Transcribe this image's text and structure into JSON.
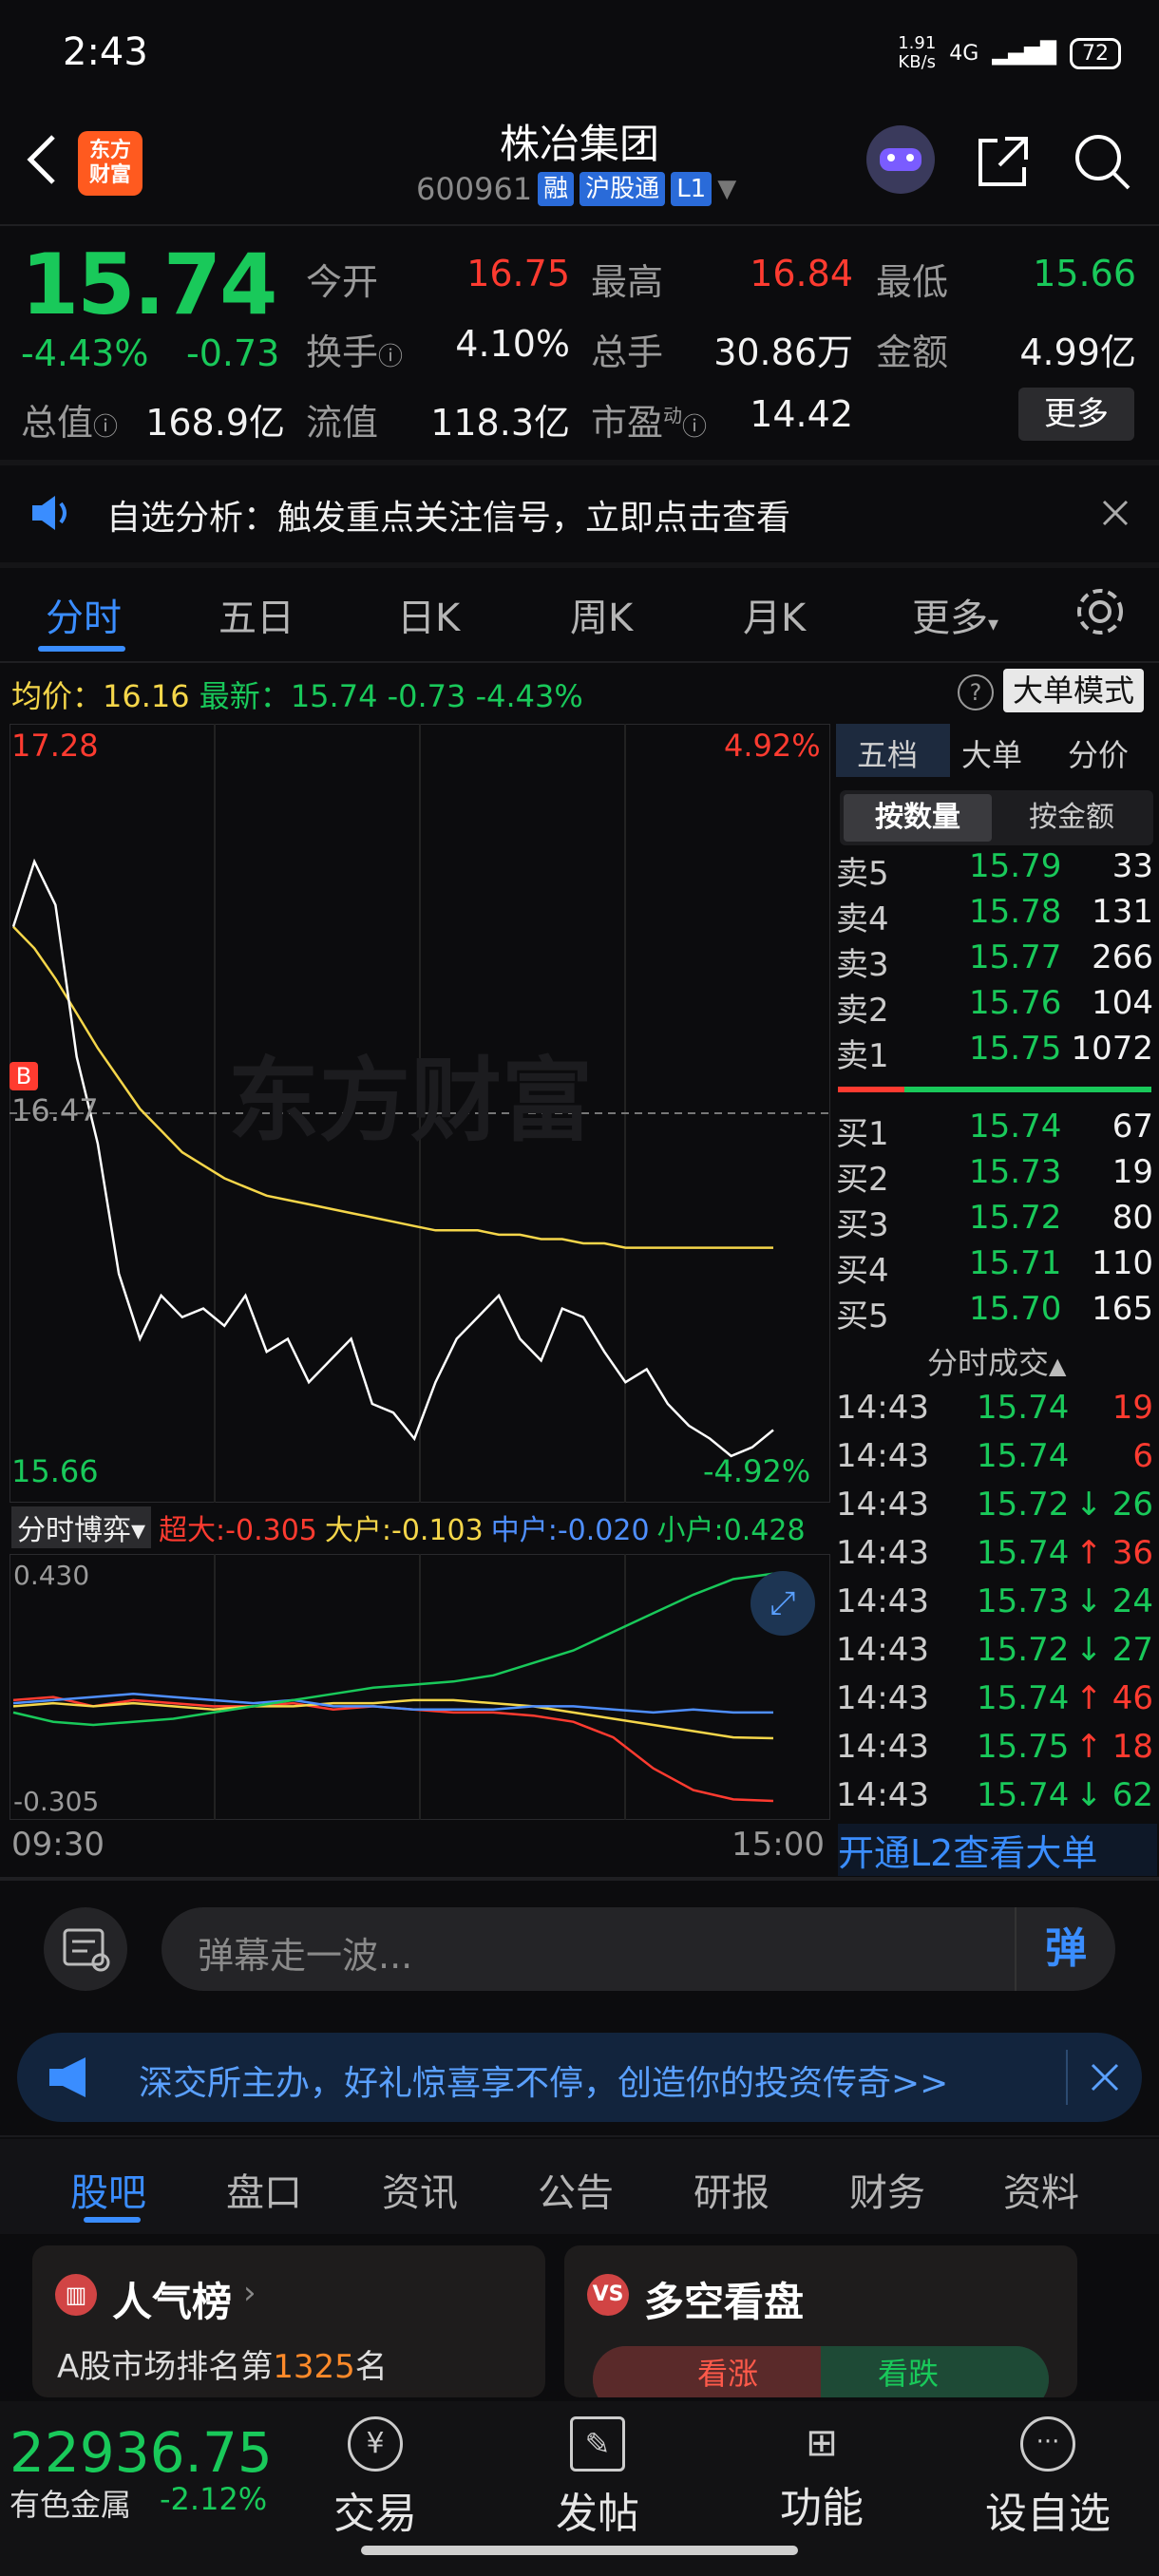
{
  "status": {
    "time": "2:43",
    "net_speed": "1.91\nKB/s",
    "signal": "4G",
    "battery": "72"
  },
  "header": {
    "title": "株冶集团",
    "code": "600961",
    "tags": [
      "融",
      "沪股通",
      "L1"
    ],
    "logo": "东方\n财富"
  },
  "quote": {
    "price": "15.74",
    "pct": "-4.43%",
    "chg": "-0.73",
    "fields": [
      {
        "label": "今开",
        "value": "16.75",
        "color": "red"
      },
      {
        "label": "最高",
        "value": "16.84",
        "color": "red"
      },
      {
        "label": "最低",
        "value": "15.66",
        "color": "green"
      },
      {
        "label": "换手",
        "value": "4.10%",
        "color": "white"
      },
      {
        "label": "总手",
        "value": "30.86万",
        "color": "white"
      },
      {
        "label": "金额",
        "value": "4.99亿",
        "color": "white"
      },
      {
        "label": "总值",
        "value": "168.9亿",
        "color": "white"
      },
      {
        "label": "流值",
        "value": "118.3亿",
        "color": "white"
      },
      {
        "label": "市盈",
        "value": "14.42",
        "color": "white"
      }
    ],
    "pe_sup": "动",
    "more_label": "更多"
  },
  "notice": {
    "text": "自选分析：触发重点关注信号，立即点击查看"
  },
  "tabs": [
    "分时",
    "五日",
    "日K",
    "周K",
    "月K",
    "更多"
  ],
  "chart_header": {
    "avg_label": "均价：",
    "avg_value": "16.16",
    "latest_label": "最新：",
    "latest_value": "15.74",
    "chg": "-0.73",
    "pct": "-4.43%",
    "mode": "大单模式"
  },
  "chart_data": {
    "type": "line",
    "y_high": "17.28",
    "y_high_pct": "4.92%",
    "y_low": "15.66",
    "y_low_pct": "-4.92%",
    "prev_close": "16.47",
    "watermark": "东方财富",
    "x_start": "09:30",
    "x_end": "15:00",
    "price_range": [
      15.66,
      17.28
    ],
    "series": [
      {
        "name": "price",
        "color": "#ffffff",
        "values": [
          16.9,
          17.05,
          16.95,
          16.6,
          16.4,
          16.1,
          15.95,
          16.05,
          16.0,
          16.02,
          15.98,
          16.05,
          15.92,
          15.95,
          15.85,
          15.9,
          15.95,
          15.8,
          15.78,
          15.72,
          15.85,
          15.95,
          16.0,
          16.05,
          15.95,
          15.9,
          16.02,
          16.0,
          15.92,
          15.85,
          15.88,
          15.8,
          15.75,
          15.72,
          15.68,
          15.7,
          15.74
        ]
      },
      {
        "name": "avg",
        "color": "#f5d64a",
        "values": [
          16.9,
          16.85,
          16.78,
          16.7,
          16.62,
          16.55,
          16.48,
          16.43,
          16.38,
          16.35,
          16.32,
          16.3,
          16.28,
          16.27,
          16.26,
          16.25,
          16.24,
          16.23,
          16.22,
          16.21,
          16.2,
          16.2,
          16.2,
          16.19,
          16.19,
          16.18,
          16.18,
          16.17,
          16.17,
          16.16,
          16.16,
          16.16,
          16.16,
          16.16,
          16.16,
          16.16,
          16.16
        ]
      }
    ],
    "flow": {
      "title": "分时博弈",
      "labels": [
        {
          "text": "超大:-0.305",
          "color": "#ff3b30"
        },
        {
          "text": "大户:-0.103",
          "color": "#f5d64a"
        },
        {
          "text": "中户:-0.020",
          "color": "#4f8fff"
        },
        {
          "text": "小户:0.428",
          "color": "#19c95a"
        }
      ],
      "y_max": "0.430",
      "y_min": "-0.305",
      "range": [
        -0.305,
        0.43
      ],
      "series": [
        {
          "name": "超大",
          "color": "#ff3b30",
          "values": [
            0.02,
            0.03,
            0.0,
            0.02,
            0.01,
            0.0,
            0.0,
            0.01,
            -0.01,
            0.0,
            -0.01,
            -0.02,
            -0.02,
            -0.03,
            -0.05,
            -0.1,
            -0.2,
            -0.27,
            -0.3,
            -0.305
          ]
        },
        {
          "name": "大户",
          "color": "#f5d64a",
          "values": [
            0.0,
            0.01,
            0.0,
            0.01,
            0.0,
            -0.01,
            0.0,
            0.0,
            0.01,
            0.01,
            0.02,
            0.02,
            0.01,
            0.0,
            -0.02,
            -0.04,
            -0.06,
            -0.08,
            -0.1,
            -0.103
          ]
        },
        {
          "name": "中户",
          "color": "#4f8fff",
          "values": [
            0.01,
            0.02,
            0.03,
            0.04,
            0.03,
            0.02,
            0.01,
            0.02,
            0.0,
            0.0,
            -0.01,
            -0.01,
            -0.01,
            0.0,
            0.0,
            -0.01,
            -0.02,
            -0.01,
            -0.02,
            -0.02
          ]
        },
        {
          "name": "小户",
          "color": "#19c95a",
          "values": [
            -0.02,
            -0.05,
            -0.06,
            -0.05,
            -0.04,
            -0.02,
            0.0,
            0.02,
            0.04,
            0.06,
            0.07,
            0.08,
            0.1,
            0.14,
            0.18,
            0.24,
            0.3,
            0.36,
            0.41,
            0.428
          ]
        }
      ]
    }
  },
  "right_panel": {
    "tabs": [
      "五档",
      "大单",
      "分价"
    ],
    "sub_tabs": [
      "按数量",
      "按金额"
    ],
    "sells": [
      {
        "label": "卖5",
        "price": "15.79",
        "vol": "33"
      },
      {
        "label": "卖4",
        "price": "15.78",
        "vol": "131"
      },
      {
        "label": "卖3",
        "price": "15.77",
        "vol": "266"
      },
      {
        "label": "卖2",
        "price": "15.76",
        "vol": "104"
      },
      {
        "label": "卖1",
        "price": "15.75",
        "vol": "1072"
      }
    ],
    "buys": [
      {
        "label": "买1",
        "price": "15.74",
        "vol": "67"
      },
      {
        "label": "买2",
        "price": "15.73",
        "vol": "19"
      },
      {
        "label": "买3",
        "price": "15.72",
        "vol": "80"
      },
      {
        "label": "买4",
        "price": "15.71",
        "vol": "110"
      },
      {
        "label": "买5",
        "price": "15.70",
        "vol": "165"
      }
    ],
    "trades_title": "分时成交",
    "trades": [
      {
        "time": "14:43",
        "price": "15.74",
        "arrow": "",
        "vol": "19",
        "vc": "red"
      },
      {
        "time": "14:43",
        "price": "15.74",
        "arrow": "",
        "vol": "6",
        "vc": "red"
      },
      {
        "time": "14:43",
        "price": "15.72",
        "arrow": "↓",
        "vol": "26",
        "vc": "green"
      },
      {
        "time": "14:43",
        "price": "15.74",
        "arrow": "↑",
        "vol": "36",
        "vc": "red"
      },
      {
        "time": "14:43",
        "price": "15.73",
        "arrow": "↓",
        "vol": "24",
        "vc": "green"
      },
      {
        "time": "14:43",
        "price": "15.72",
        "arrow": "↓",
        "vol": "27",
        "vc": "green"
      },
      {
        "time": "14:43",
        "price": "15.74",
        "arrow": "↑",
        "vol": "46",
        "vc": "red"
      },
      {
        "time": "14:43",
        "price": "15.75",
        "arrow": "↑",
        "vol": "18",
        "vc": "red"
      },
      {
        "time": "14:43",
        "price": "15.74",
        "arrow": "↓",
        "vol": "62",
        "vc": "green"
      }
    ],
    "l2_banner": "开通L2查看大单"
  },
  "comment_bar": {
    "placeholder": "弹幕走一波...",
    "danmu": "弹"
  },
  "ad": {
    "text": "深交所主办，好礼惊喜享不停，创造你的投资传奇>>"
  },
  "info_tabs": [
    "股吧",
    "盘口",
    "资讯",
    "公告",
    "研报",
    "财务",
    "资料"
  ],
  "cards": {
    "popular": {
      "title": "人气榜",
      "rank_prefix": "A股市场排名第",
      "rank": "1325",
      "rank_suffix": "名"
    },
    "bull_bear": {
      "title": "多空看盘",
      "up": "看涨",
      "down": "看跌"
    }
  },
  "bottom": {
    "index_value": "22936.75",
    "index_name": "有色金属",
    "index_pct": "-2.12%",
    "nav": [
      "交易",
      "发帖",
      "功能",
      "设自选"
    ]
  }
}
